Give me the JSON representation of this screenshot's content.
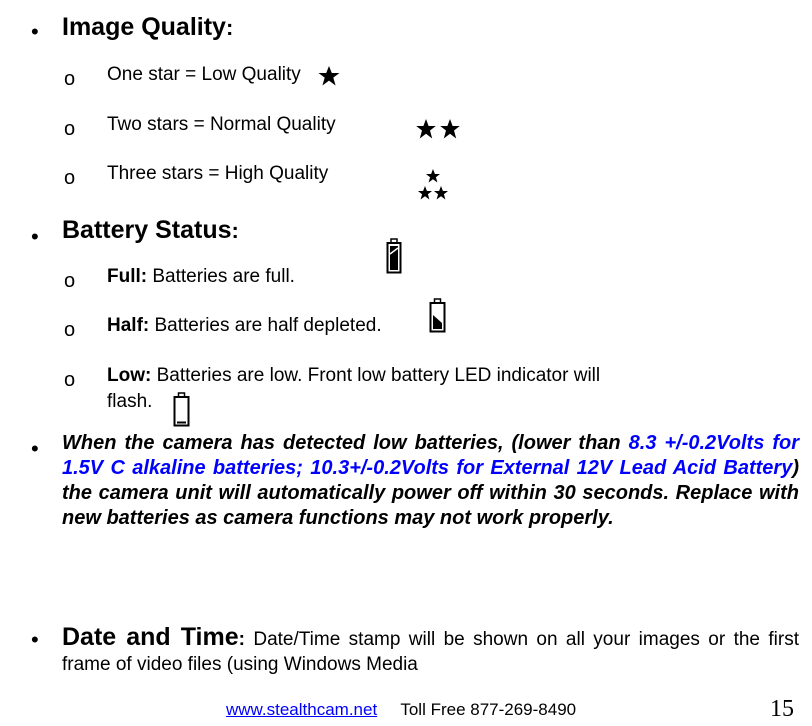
{
  "image_quality": {
    "heading": "Image Quality",
    "colon": ":",
    "items": [
      {
        "text": "One star = Low Quality",
        "stars": 1
      },
      {
        "text": "Two stars = Normal Quality",
        "stars": 2
      },
      {
        "text": "Three stars = High Quality",
        "stars": 3
      }
    ]
  },
  "battery_status": {
    "heading": "Battery Status",
    "colon": ":",
    "items": [
      {
        "label": "Full:",
        "text": " Batteries are full.",
        "level": 1.0
      },
      {
        "label": "Half:",
        "text": " Batteries are half depleted.",
        "level": 0.5
      },
      {
        "label": "Low:",
        "text": " Batteries are low. Front low battery LED indicator will",
        "text2": "flash.",
        "level": 0.0
      }
    ]
  },
  "warning": {
    "part1": "When the camera has detected low batteries, (lower than ",
    "blue": "8.3 +/-0.2Volts for 1.5V C alkaline batteries; 10.3+/-0.2Volts for External 12V Lead Acid Battery",
    "part2": ") the camera unit will automatically power off within 30 seconds. Replace with new batteries as camera functions may not work properly."
  },
  "date_time": {
    "heading": "Date and Time",
    "colon": ":",
    "text": " Date/Time stamp will be shown on all your images or the first frame of video files (using Windows Media"
  },
  "footer": {
    "website": "www.stealthcam.net",
    "phone": "Toll Free 877-269-8490",
    "page_number": "15"
  },
  "symbols": {
    "bullet": "•",
    "sub_bullet": "o"
  }
}
